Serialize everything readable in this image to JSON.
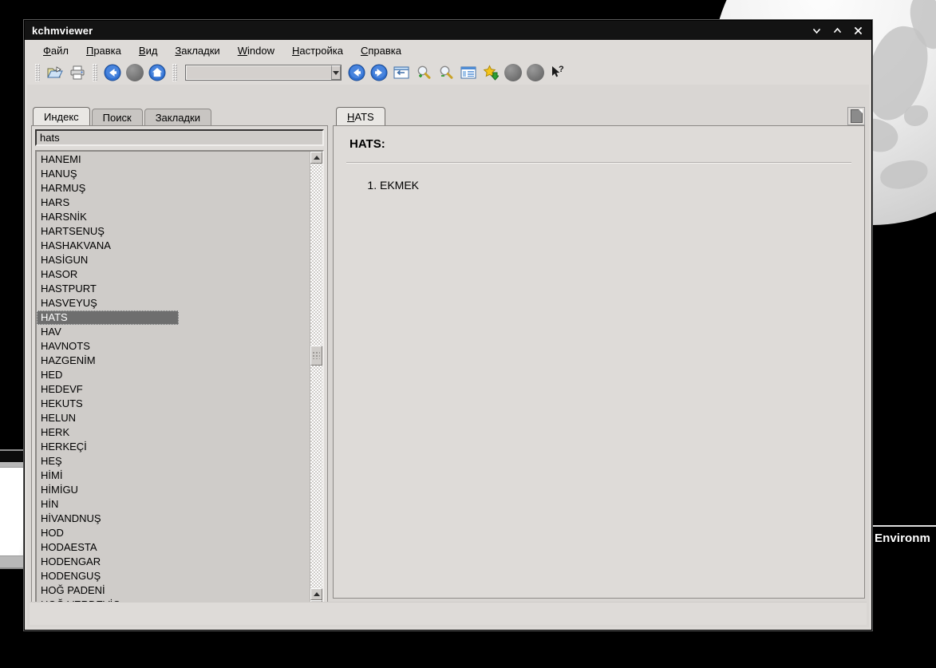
{
  "window": {
    "title": "kchmviewer",
    "controls": [
      {
        "name": "minimize",
        "glyph": "v"
      },
      {
        "name": "maximize",
        "glyph": "^"
      },
      {
        "name": "close",
        "glyph": "x"
      }
    ]
  },
  "menubar": {
    "items": [
      {
        "accel": "Ф",
        "rest": "айл"
      },
      {
        "accel": "П",
        "rest": "равка"
      },
      {
        "accel": "В",
        "rest": "ид"
      },
      {
        "accel": "З",
        "rest": "акладки"
      },
      {
        "accel": "W",
        "rest": "indow"
      },
      {
        "accel": "Н",
        "rest": "астройка"
      },
      {
        "accel": "С",
        "rest": "правка"
      }
    ]
  },
  "toolbar": {
    "buttons": [
      {
        "name": "open-file-icon",
        "tip": "Open file"
      },
      {
        "name": "print-icon",
        "tip": "Print"
      },
      {
        "name": "navigate-back-icon",
        "tip": "Back"
      },
      {
        "name": "navigate-forward-disabled-icon",
        "tip": "Forward"
      },
      {
        "name": "home-icon",
        "tip": "Home"
      },
      {
        "name": "history-back-icon",
        "tip": "Previous page"
      },
      {
        "name": "history-forward-icon",
        "tip": "Next page"
      },
      {
        "name": "toggle-navigator-icon",
        "tip": "Show/hide navigator"
      },
      {
        "name": "zoom-in-icon",
        "tip": "Increase font size"
      },
      {
        "name": "zoom-out-icon",
        "tip": "Decrease font size"
      },
      {
        "name": "view-source-icon",
        "tip": "View HTML source"
      },
      {
        "name": "add-bookmark-icon",
        "tip": "Add bookmark"
      },
      {
        "name": "disabled-1-icon",
        "tip": ""
      },
      {
        "name": "disabled-2-icon",
        "tip": ""
      },
      {
        "name": "whats-this-icon",
        "tip": "What's this?"
      }
    ],
    "combo_value": "",
    "combo_placeholder": ""
  },
  "left_pane": {
    "tabs": [
      {
        "label": "Индекс",
        "active": true
      },
      {
        "label": "Поиск",
        "active": false
      },
      {
        "label": "Закладки",
        "active": false
      }
    ],
    "search": {
      "value": "hats",
      "placeholder": ""
    },
    "selected_item": "HATS",
    "items": [
      "HANEMI",
      "HANUŞ",
      "HARMUŞ",
      "HARS",
      "HARSNİK",
      "HARTSENUŞ",
      "HASHAKVANA",
      "HASİGUN",
      "HASOR",
      "HASTPURT",
      "HASVEYUŞ",
      "HATS",
      "HAV",
      "HAVNOTS",
      "HAZGENİM",
      "HED",
      "HEDEVF",
      "HEKUTS",
      "HELUN",
      "HERK",
      "HERKEÇİ",
      "HEŞ",
      "HİMİ",
      "HİMİGU",
      "HİN",
      "HİVANDNUŞ",
      "HOD",
      "HODAESTA",
      "HODENGAR",
      "HODENGUŞ",
      "HOĞ PADENİ",
      "HOĞ VERDEVİÇ"
    ]
  },
  "right_pane": {
    "tab": {
      "accel": "H",
      "rest": "ATS"
    },
    "document": {
      "heading": "HATS:",
      "entries": [
        "EKMEK"
      ]
    }
  },
  "statusbar": {
    "text": ""
  },
  "background": {
    "right_window_text": "Environm"
  },
  "colors": {
    "titlebar": "#131313",
    "window_face": "#dedbd8",
    "field": "#cfccc9",
    "selection": "#6e6e6e",
    "selection_text": "#ffffff",
    "accent_blue": "#2f6fd0"
  }
}
